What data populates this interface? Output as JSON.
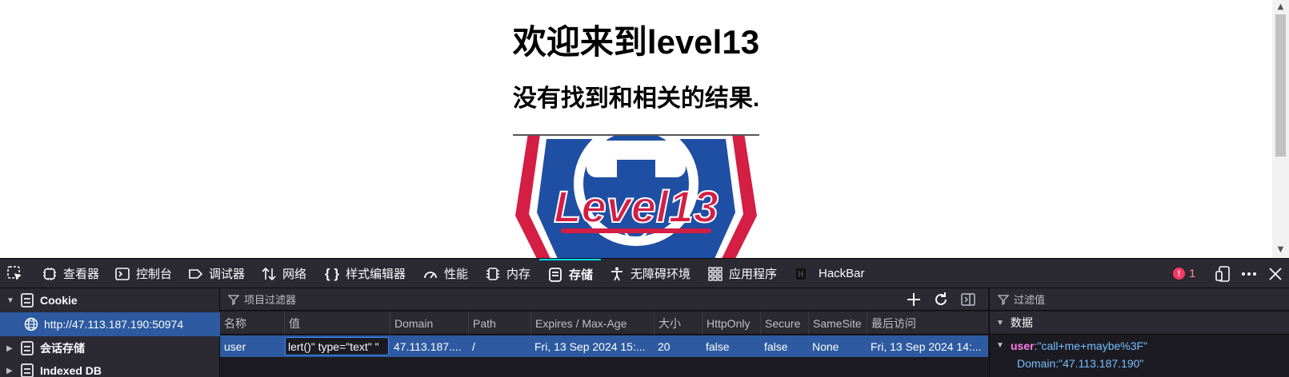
{
  "page": {
    "heading": "欢迎来到level13",
    "subheading": "没有找到和相关的结果.",
    "logo_text": "Level13"
  },
  "toolbar": {
    "tools": [
      {
        "label": "查看器",
        "icon": "inspector-icon"
      },
      {
        "label": "控制台",
        "icon": "console-icon"
      },
      {
        "label": "调试器",
        "icon": "debugger-icon"
      },
      {
        "label": "网络",
        "icon": "network-icon"
      },
      {
        "label": "样式编辑器",
        "icon": "style-editor-icon"
      },
      {
        "label": "性能",
        "icon": "performance-icon"
      },
      {
        "label": "内存",
        "icon": "memory-icon"
      },
      {
        "label": "存储",
        "icon": "storage-icon",
        "selected": true
      },
      {
        "label": "无障碍环境",
        "icon": "accessibility-icon"
      },
      {
        "label": "应用程序",
        "icon": "application-icon"
      },
      {
        "label": "HackBar",
        "icon": "hackbar-icon"
      }
    ],
    "error_count": "1"
  },
  "sidebar": {
    "items": [
      {
        "label": "Cookie",
        "expanded": true
      },
      {
        "label": "http://47.113.187.190:50974"
      },
      {
        "label": "会话存储"
      },
      {
        "label": "Indexed DB"
      }
    ]
  },
  "table": {
    "filter_placeholder": "项目过滤器",
    "columns": [
      "名称",
      "值",
      "Domain",
      "Path",
      "Expires / Max-Age",
      "大小",
      "HttpOnly",
      "Secure",
      "SameSite",
      "最后访问"
    ],
    "rows": [
      [
        "user",
        "lert()\" type=\"text\" \"",
        "47.113.187....",
        "/",
        "Fri, 13 Sep 2024 15:...",
        "20",
        "false",
        "false",
        "None",
        "Fri, 13 Sep 2024 14:..."
      ]
    ]
  },
  "details": {
    "filter_placeholder": "过滤值",
    "section": "数据",
    "entries": [
      {
        "key": "user",
        "value": "\"call+me+maybe%3F\""
      },
      {
        "key": "Domain",
        "value": "\"47.113.187.190\""
      }
    ]
  },
  "colors": {
    "devtools_bg": "#1c1b22",
    "toolbar_bg": "#2b2a33",
    "selection": "#2d5aa0",
    "accent": "#00ddff",
    "logo_red": "#d41e44",
    "logo_blue": "#1f4fa3"
  }
}
